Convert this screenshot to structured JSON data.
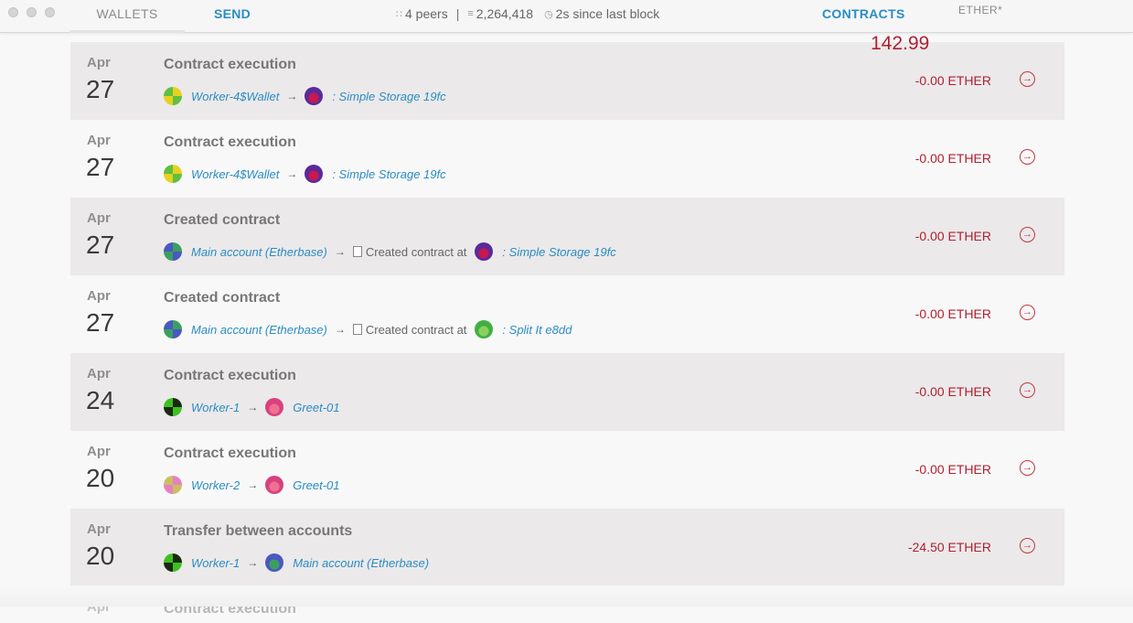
{
  "nav": {
    "wallets_label": "WALLETS",
    "send_label": "SEND",
    "contracts_label": "CONTRACTS"
  },
  "status": {
    "peers": "4 peers",
    "block": "2,264,418",
    "last_block": "2s since last block"
  },
  "balance": {
    "amount": "142.99",
    "unit": "ETHER*"
  },
  "transactions": [
    {
      "month": "Apr",
      "day": "27",
      "title": "Contract execution",
      "from": "Worker-4$Wallet",
      "to": ": Simple Storage 19fc",
      "amount": "-0.00 ETHER",
      "from_colors": [
        "#e8d020",
        "#60c040"
      ],
      "to_colors": [
        "#c81850",
        "#5a2a9a"
      ]
    },
    {
      "month": "Apr",
      "day": "27",
      "title": "Contract execution",
      "from": "Worker-4$Wallet",
      "to": ": Simple Storage 19fc",
      "amount": "-0.00 ETHER",
      "from_colors": [
        "#e8d020",
        "#60c040"
      ],
      "to_colors": [
        "#c81850",
        "#5a2a9a"
      ]
    },
    {
      "month": "Apr",
      "day": "27",
      "title": "Created contract",
      "from": "Main account (Etherbase)",
      "created_label": "Created contract at",
      "to": ": Simple Storage 19fc",
      "amount": "-0.00 ETHER",
      "from_colors": [
        "#3aa060",
        "#4a58c0"
      ],
      "to_colors": [
        "#c81850",
        "#5a2a9a"
      ]
    },
    {
      "month": "Apr",
      "day": "27",
      "title": "Created contract",
      "from": "Main account (Etherbase)",
      "created_label": "Created contract at",
      "to": ": Split It e8dd",
      "amount": "-0.00 ETHER",
      "from_colors": [
        "#3aa060",
        "#4a58c0"
      ],
      "to_colors": [
        "#8ad060",
        "#40b040"
      ]
    },
    {
      "month": "Apr",
      "day": "24",
      "title": "Contract execution",
      "from": "Worker-1",
      "to": "Greet-01",
      "amount": "-0.00 ETHER",
      "from_colors": [
        "#1a2a10",
        "#40c020"
      ],
      "to_colors": [
        "#f07090",
        "#d84080"
      ]
    },
    {
      "month": "Apr",
      "day": "20",
      "title": "Contract execution",
      "from": "Worker-2",
      "to": "Greet-01",
      "amount": "-0.00 ETHER",
      "from_colors": [
        "#e880c0",
        "#c8c060"
      ],
      "to_colors": [
        "#f07090",
        "#d84080"
      ]
    },
    {
      "month": "Apr",
      "day": "20",
      "title": "Transfer between accounts",
      "from": "Worker-1",
      "to": "Main account (Etherbase)",
      "amount": "-24.50 ETHER",
      "from_colors": [
        "#1a2a10",
        "#40c020"
      ],
      "to_colors": [
        "#3aa060",
        "#4a58c0"
      ]
    },
    {
      "month": "Apr",
      "day": "",
      "title": "Contract execution",
      "from": "",
      "to": "",
      "amount": "",
      "from_colors": [
        "#ccc",
        "#ccc"
      ],
      "to_colors": [
        "#ccc",
        "#ccc"
      ]
    }
  ],
  "colors": {
    "link": "#2a8cc4",
    "amount": "#b02030",
    "shaded_row": "#ebe9ea"
  }
}
